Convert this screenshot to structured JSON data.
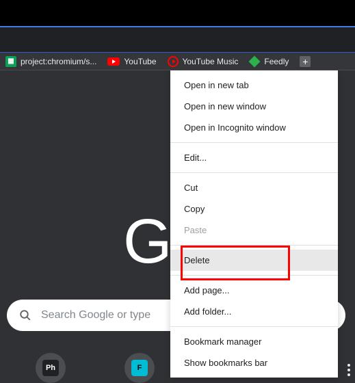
{
  "bookmarks": {
    "item1": "project:chromium/s...",
    "item2": "YouTube",
    "item3": "YouTube Music",
    "item4": "Feedly"
  },
  "logo_text": "G",
  "search": {
    "placeholder": "Search Google or type"
  },
  "shortcuts": {
    "tile1_label": "Ph",
    "tile2_label": "F"
  },
  "menu": {
    "open_new_tab": "Open in new tab",
    "open_new_window": "Open in new window",
    "open_incognito": "Open in Incognito window",
    "edit": "Edit...",
    "cut": "Cut",
    "copy": "Copy",
    "paste": "Paste",
    "delete": "Delete",
    "add_page": "Add page...",
    "add_folder": "Add folder...",
    "bookmark_manager": "Bookmark manager",
    "show_bookmarks_bar": "Show bookmarks bar"
  }
}
